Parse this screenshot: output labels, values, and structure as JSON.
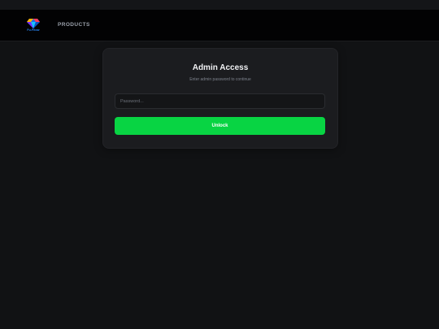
{
  "brand": {
    "logo_text": "Fu.Fitow",
    "logo_icon": "gem-icon",
    "accent": "#2a8cff"
  },
  "nav": {
    "products_label": "PRODUCTS"
  },
  "login": {
    "title": "Admin Access",
    "subtitle": "Enter admin password to continue",
    "password_placeholder": "Password...",
    "password_value": "",
    "unlock_label": "Unlock",
    "button_color": "#08d443"
  }
}
